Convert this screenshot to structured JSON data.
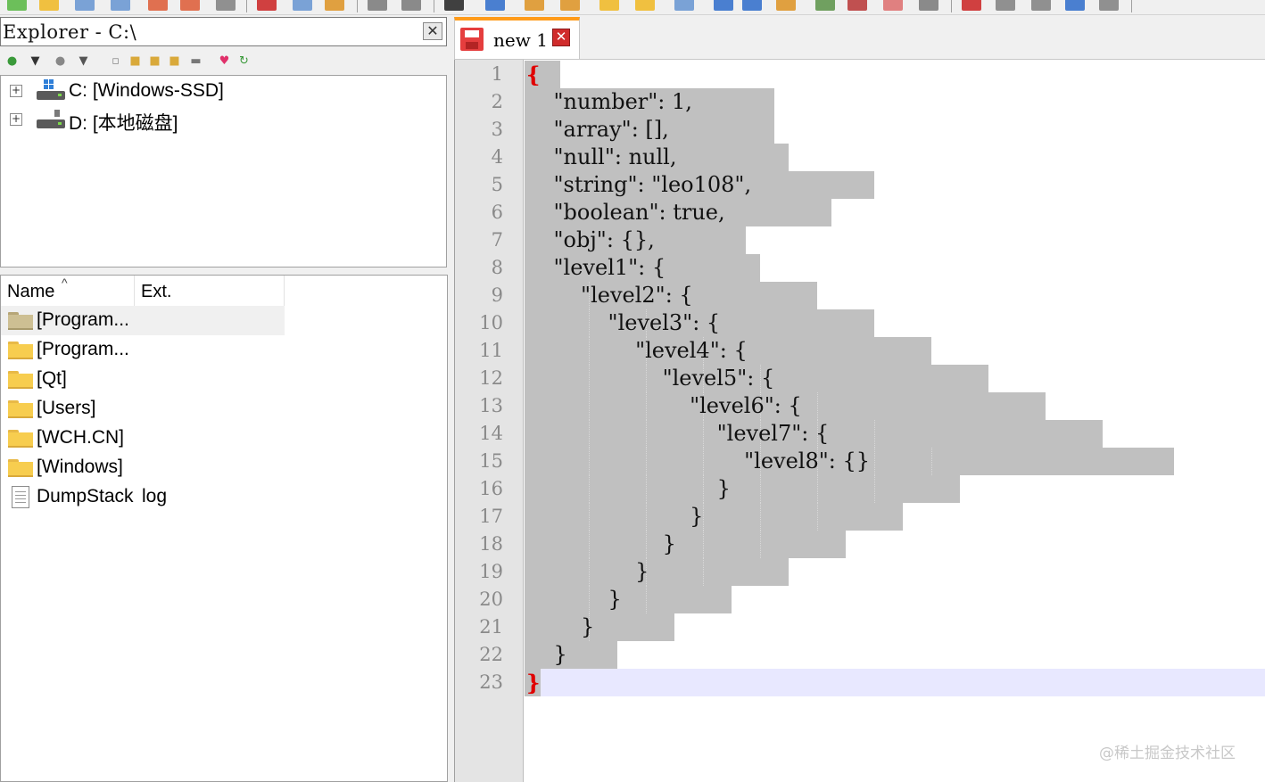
{
  "explorer": {
    "title": "Explorer - C:\\",
    "close_label": "✕",
    "drives": [
      {
        "label": "C: [Windows-SSD]"
      },
      {
        "label": "D: [本地磁盘]"
      }
    ],
    "columns": {
      "name": "Name",
      "ext": "Ext."
    },
    "files": [
      {
        "name": "[Program...",
        "ext": "",
        "icon": "folder-icon-grey"
      },
      {
        "name": "[Program...",
        "ext": "",
        "icon": "folder-icon"
      },
      {
        "name": "[Qt]",
        "ext": "",
        "icon": "folder-icon"
      },
      {
        "name": "[Users]",
        "ext": "",
        "icon": "folder-icon"
      },
      {
        "name": "[WCH.CN]",
        "ext": "",
        "icon": "folder-icon"
      },
      {
        "name": "[Windows]",
        "ext": "",
        "icon": "folder-icon"
      },
      {
        "name": "DumpStack",
        "ext": "log",
        "icon": "document-icon"
      }
    ]
  },
  "editor": {
    "tab_label": "new 1",
    "line_numbers": [
      "1",
      "2",
      "3",
      "4",
      "5",
      "6",
      "7",
      "8",
      "9",
      "10",
      "11",
      "12",
      "13",
      "14",
      "15",
      "16",
      "17",
      "18",
      "19",
      "20",
      "21",
      "22",
      "23"
    ],
    "lines": [
      "{",
      "    \"number\": 1,",
      "    \"array\": [],",
      "    \"null\": null,",
      "    \"string\": \"leo108\",",
      "    \"boolean\": true,",
      "    \"obj\": {},",
      "    \"level1\": {",
      "        \"level2\": {",
      "            \"level3\": {",
      "                \"level4\": {",
      "                    \"level5\": {",
      "                        \"level6\": {",
      "                            \"level7\": {",
      "                                \"level8\": {}",
      "                            }",
      "                        }",
      "                    }",
      "                }",
      "            }",
      "        }",
      "    }",
      "}"
    ]
  },
  "watermark": "@稀土掘金技术社区",
  "colors": {
    "tab_accent": "#ff9b1a",
    "selection": "#c0c0c0",
    "current_line": "#e8e8ff",
    "brace_match": "#e00000"
  }
}
